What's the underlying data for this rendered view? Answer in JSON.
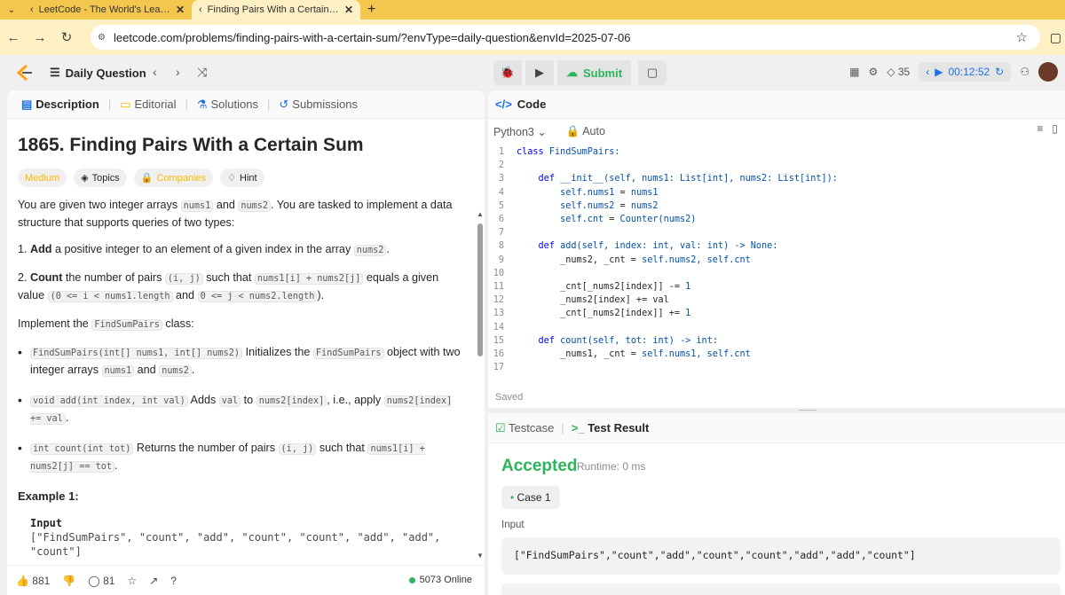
{
  "browser": {
    "tabs": [
      {
        "label": "LeetCode - The World's Leading",
        "active": false
      },
      {
        "label": "Finding Pairs With a Certain Sum",
        "active": true
      }
    ],
    "url": "leetcode.com/problems/finding-pairs-with-a-certain-sum/?envType=daily-question&envId=2025-07-06"
  },
  "topnav": {
    "daily_label": "Daily Question",
    "submit_label": "Submit",
    "streak": "35",
    "timer": "00:12:52"
  },
  "left_tabs": [
    {
      "label": "Description",
      "active": true
    },
    {
      "label": "Editorial"
    },
    {
      "label": "Solutions"
    },
    {
      "label": "Submissions"
    }
  ],
  "problem": {
    "title": "1865. Finding Pairs With a Certain Sum",
    "tags": [
      "Medium",
      "Topics",
      "Companies",
      "Hint"
    ],
    "example_title": "Example 1:",
    "input_label": "Input",
    "input_line1": "[\"FindSumPairs\", \"count\", \"add\", \"count\", \"count\", \"add\", \"add\",",
    "input_line2": "\"count\"]"
  },
  "footer": {
    "likes": "881",
    "comments": "81",
    "online": "5073 Online"
  },
  "code_panel": {
    "title": "Code",
    "language": "Python3",
    "mode": "Auto",
    "saved": "Saved"
  },
  "result_panel": {
    "tab_testcase": "Testcase",
    "tab_result": "Test Result",
    "status": "Accepted",
    "runtime": "Runtime: 0 ms",
    "case": "Case 1",
    "input_label": "Input",
    "input_value": "[\"FindSumPairs\",\"count\",\"add\",\"count\",\"count\",\"add\",\"add\",\"count\"]"
  },
  "colors": {
    "accent_green": "#2db55d",
    "medium": "#ffb800",
    "tabbar": "#f3c64d"
  }
}
